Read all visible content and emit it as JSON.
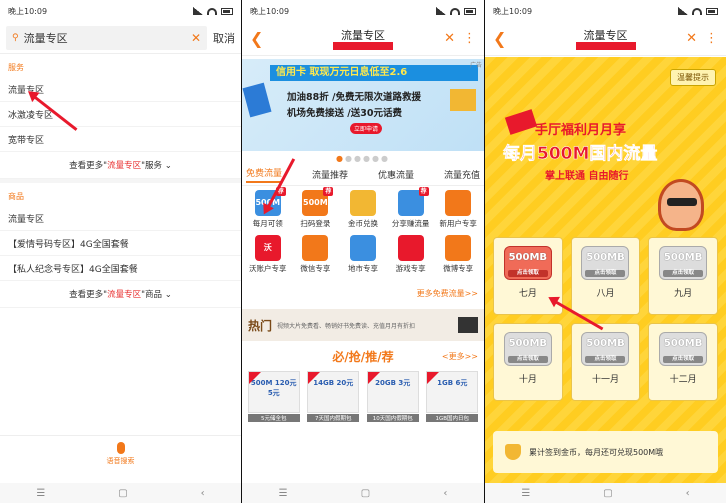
{
  "status_time": "晚上10:09",
  "panel1": {
    "search_query": "流量专区",
    "cancel_label": "取消",
    "section_service": "服务",
    "service_items": [
      "流量专区",
      "冰激凌专区",
      "宽带专区"
    ],
    "more_service": {
      "prefix": "查看更多\"",
      "keyword": "流量专区",
      "suffix": "\"服务"
    },
    "section_goods": "商品",
    "goods_items": [
      "流量专区",
      "【爱情号码专区】4G全国套餐",
      "【私人纪念号专区】4G全国套餐"
    ],
    "more_goods": {
      "prefix": "查看更多\"",
      "keyword": "流量专区",
      "suffix": "\"商品"
    },
    "voice_label": "语音搜索"
  },
  "panel2": {
    "title": "流量专区",
    "banner": {
      "line1": "信用卡 取现万元日息低至2.6",
      "line2": "加油88折 /免费无限次道路救援",
      "line3": "机场免费接送 /送30元话费",
      "apply": "立即申请",
      "ad": "广告"
    },
    "tabs": [
      "免费流量",
      "流量推荐",
      "优惠流量",
      "流量充值"
    ],
    "grid": [
      {
        "label": "每月可领",
        "icon": "gift-icon",
        "color": "#3b8fe0",
        "text": "500M",
        "tag": "荐"
      },
      {
        "label": "扫码登录",
        "icon": "scan-icon",
        "color": "#f2781a",
        "text": "500M",
        "tag": "荐"
      },
      {
        "label": "金币兑换",
        "icon": "coin-icon",
        "color": "#f2b733",
        "text": "",
        "tag": ""
      },
      {
        "label": "分享赚流量",
        "icon": "share-icon",
        "color": "#3b8fe0",
        "text": "",
        "tag": "荐"
      },
      {
        "label": "新用户专享",
        "icon": "user-icon",
        "color": "#f2781a",
        "text": "",
        "tag": ""
      },
      {
        "label": "沃账户专享",
        "icon": "wo-icon",
        "color": "#e8192c",
        "text": "沃",
        "tag": ""
      },
      {
        "label": "微信专享",
        "icon": "wechat-icon",
        "color": "#f2781a",
        "text": "",
        "tag": ""
      },
      {
        "label": "地市专享",
        "icon": "city-icon",
        "color": "#3b8fe0",
        "text": "",
        "tag": ""
      },
      {
        "label": "游戏专享",
        "icon": "game-icon",
        "color": "#e8192c",
        "text": "",
        "tag": ""
      },
      {
        "label": "微博专享",
        "icon": "weibo-icon",
        "color": "#f2781a",
        "text": "",
        "tag": ""
      }
    ],
    "more_free": "更多免费流量>>",
    "hot": {
      "title": "热门",
      "text": "视频大片免费看、畅销好书免费读、充值月月有折扣"
    },
    "bqt": {
      "title": "必/抢/推/荐",
      "more": "<更多>>"
    },
    "cards": [
      {
        "main": "500M 120元 5元",
        "caption": "5元储全包"
      },
      {
        "main": "14GB 20元",
        "caption": "7天国内假期包"
      },
      {
        "main": "20GB 3元",
        "caption": "10天国内假期包"
      },
      {
        "main": "1GB 6元",
        "caption": "1GB国内日包"
      }
    ]
  },
  "panel3": {
    "title": "流量专区",
    "tip": "温馨提示",
    "head1": "手厅福利月月享",
    "head2": "每月500M国内流量",
    "head3": "掌上联通 自由随行",
    "coupon_text": "500MB",
    "coupon_sub": "点击领取",
    "months": [
      "七月",
      "八月",
      "九月",
      "十月",
      "十一月",
      "十二月"
    ],
    "note": "累计签到金币，每月还可兑现500M哦"
  }
}
